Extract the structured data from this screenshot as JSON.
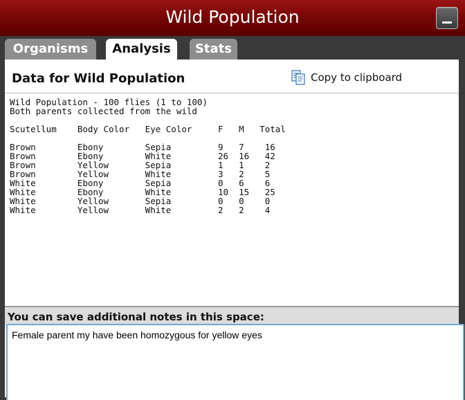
{
  "window": {
    "title": "Wild Population"
  },
  "tabs": [
    {
      "label": "Organisms",
      "active": false
    },
    {
      "label": "Analysis",
      "active": true
    },
    {
      "label": "Stats",
      "active": false
    }
  ],
  "header": {
    "title": "Data for Wild Population",
    "copy_label": "Copy to clipboard"
  },
  "data_lines": [
    "Wild Population - 100 flies (1 to 100)",
    "Both parents collected from the wild",
    "",
    "Scutellum    Body Color   Eye Color     F   M   Total",
    "",
    "Brown        Ebony        Sepia         9   7    16",
    "Brown        Ebony        White         26  16   42",
    "Brown        Yellow       Sepia         1   1    2",
    "Brown        Yellow       White         3   2    5",
    "White        Ebony        Sepia         0   6    6",
    "White        Ebony        White         10  15   25",
    "White        Yellow       Sepia         0   0    0",
    "White        Yellow       White         2   2    4"
  ],
  "notes": {
    "label": "You can save additional notes in this space:",
    "value": "Female parent my have been homozygous for yellow eyes"
  },
  "colors": {
    "title_bar": "#7a0606",
    "tab_inactive": "#8e8e8e",
    "notes_border": "#6aa9d9"
  },
  "icons": {
    "copy": "clipboard-icon",
    "minimize": "minimize-icon"
  }
}
